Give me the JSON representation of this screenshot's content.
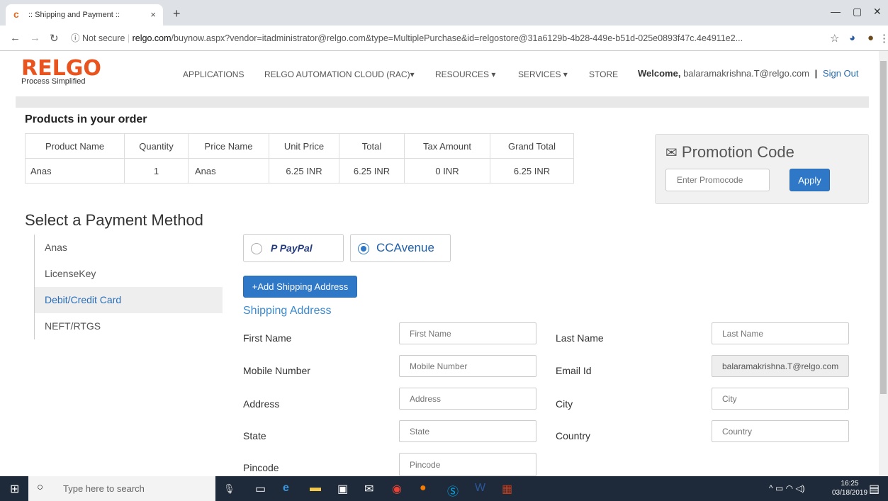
{
  "browser": {
    "tab_title": ":: Shipping and Payment ::",
    "tab_close": "×",
    "new_tab": "+",
    "window_controls": [
      "—",
      "▢",
      "✕"
    ],
    "security": "ⓘ Not secure",
    "url_host": "relgo.com",
    "url_path": "/buynow.aspx?vendor=itadministrator@relgo.com&type=MultiplePurchase&id=relgostore@31a6129b-4b28-449e-b51d-025e0893f47c.4e4911e2...",
    "icons": [
      "back-icon",
      "forward-icon",
      "reload-icon",
      "star-icon",
      "menu-icon"
    ]
  },
  "site": {
    "logo_main": "RELGO",
    "logo_tagline": "Process Simplified",
    "nav": [
      "APPLICATIONS",
      "RELGO AUTOMATION CLOUD (RAC)▾",
      "RESOURCES ▾",
      "SERVICES ▾",
      "STORE"
    ],
    "welcome_label": "Welcome,",
    "user_email": "balaramakrishna.T@relgo.com",
    "separator": "|",
    "signout": "Sign Out"
  },
  "products": {
    "title": "Products in your order",
    "headers": [
      "Product Name",
      "Quantity",
      "Price Name",
      "Unit Price",
      "Total",
      "Tax Amount",
      "Grand Total"
    ],
    "rows": [
      [
        "Anas",
        "1",
        "Anas",
        "6.25 INR",
        "6.25 INR",
        "0 INR",
        "6.25 INR"
      ]
    ]
  },
  "promo": {
    "title": "Promotion Code",
    "placeholder": "Enter Promocode",
    "apply": "Apply"
  },
  "payment": {
    "title": "Select a Payment Method",
    "methods": [
      "Anas",
      "LicenseKey",
      "Debit/Credit Card",
      "NEFT/RTGS"
    ],
    "active_method": "Debit/Credit Card",
    "gateways": [
      "PayPal",
      "CCAvenue"
    ],
    "selected_gateway": "CCAvenue",
    "add_shipping": "+Add Shipping Address"
  },
  "shipping": {
    "title": "Shipping Address",
    "labels": {
      "first_name": "First Name",
      "last_name": "Last Name",
      "mobile": "Mobile Number",
      "email": "Email Id",
      "address": "Address",
      "city": "City",
      "state": "State",
      "country": "Country",
      "pincode": "Pincode"
    },
    "placeholders": {
      "first_name": "First Name",
      "last_name": "Last Name",
      "mobile": "Mobile Number",
      "address": "Address",
      "city": "City",
      "state": "State",
      "country": "Country",
      "pincode": "Pincode"
    },
    "email_value": "balaramakrishna.T@relgo.com"
  },
  "taskbar": {
    "search_placeholder": "Type here to search",
    "time": "16:25",
    "date": "03/18/2019"
  },
  "colors": {
    "brand_orange": "#e8531e",
    "primary_blue": "#2e78c7",
    "link_blue": "#2a6eb5",
    "taskbar": "#1e2a3a"
  }
}
